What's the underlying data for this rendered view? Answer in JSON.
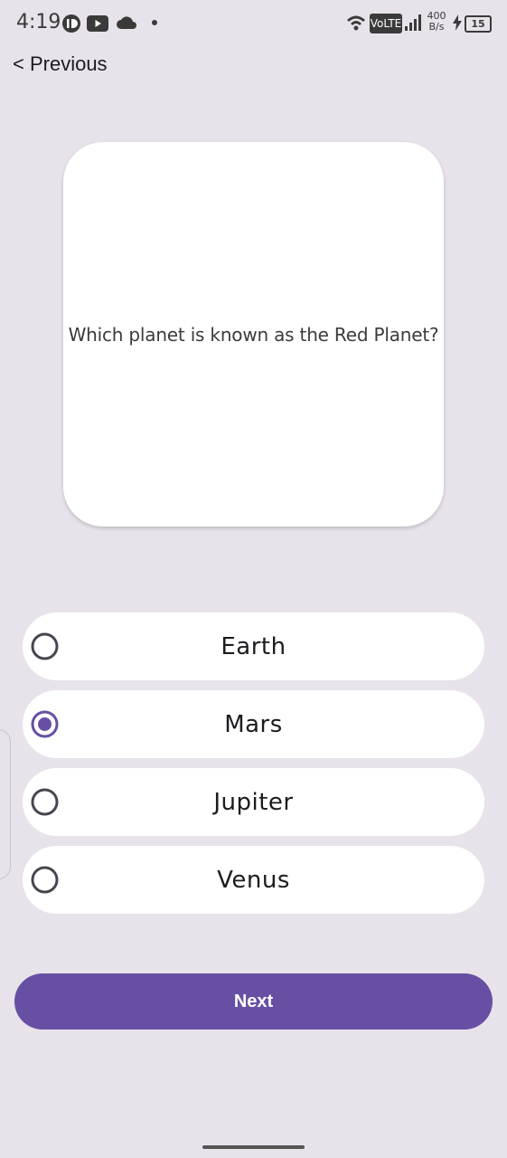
{
  "status_bar": {
    "time": "4:19",
    "network_label": "VoLTE",
    "speed_value": "400",
    "speed_unit": "B/s",
    "battery": "15"
  },
  "nav": {
    "previous_label": "< Previous"
  },
  "question": {
    "text": "Which planet is known as the Red Planet?"
  },
  "options": [
    {
      "label": "Earth",
      "selected": false
    },
    {
      "label": "Mars",
      "selected": true
    },
    {
      "label": "Jupiter",
      "selected": false
    },
    {
      "label": "Venus",
      "selected": false
    }
  ],
  "next_button": {
    "label": "Next"
  },
  "colors": {
    "accent": "#6750a4",
    "background": "#e8e3ea",
    "card": "#ffffff"
  }
}
